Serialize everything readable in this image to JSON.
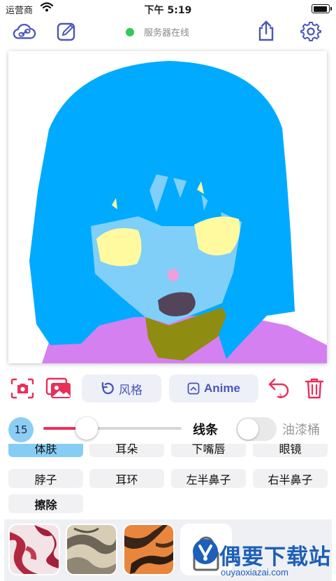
{
  "status_bar": {
    "carrier": "运营商",
    "time": "下午 5:19"
  },
  "toolbar": {
    "server_status": "服务器在线"
  },
  "actions": {
    "style_label": "风格",
    "anime_label": "Anime",
    "undo_count": "1"
  },
  "brush": {
    "size": "15",
    "line_label": "线条",
    "bucket_label": "油漆桶",
    "slider_level": 0.3,
    "bucket_on": false
  },
  "parts": [
    {
      "label": "体肤",
      "selected": true
    },
    {
      "label": "耳朵"
    },
    {
      "label": "下嘴唇"
    },
    {
      "label": "眼镜"
    },
    {
      "label": "脖子"
    },
    {
      "label": "耳环"
    },
    {
      "label": "左半鼻子"
    },
    {
      "label": "右半鼻子"
    },
    {
      "label": "擦除"
    }
  ],
  "textures": [
    "red-white-texture",
    "beige-grey-texture",
    "orange-black-texture",
    "locked-texture"
  ],
  "watermark": {
    "text": "偶要下载站",
    "url": "ouyaoxiazai.com"
  },
  "colors": {
    "accent": "#4b56b8",
    "danger": "#e8305a",
    "hair": "#00aaff",
    "skin": "#7fcff8",
    "selected_part": "#86cdf6"
  }
}
